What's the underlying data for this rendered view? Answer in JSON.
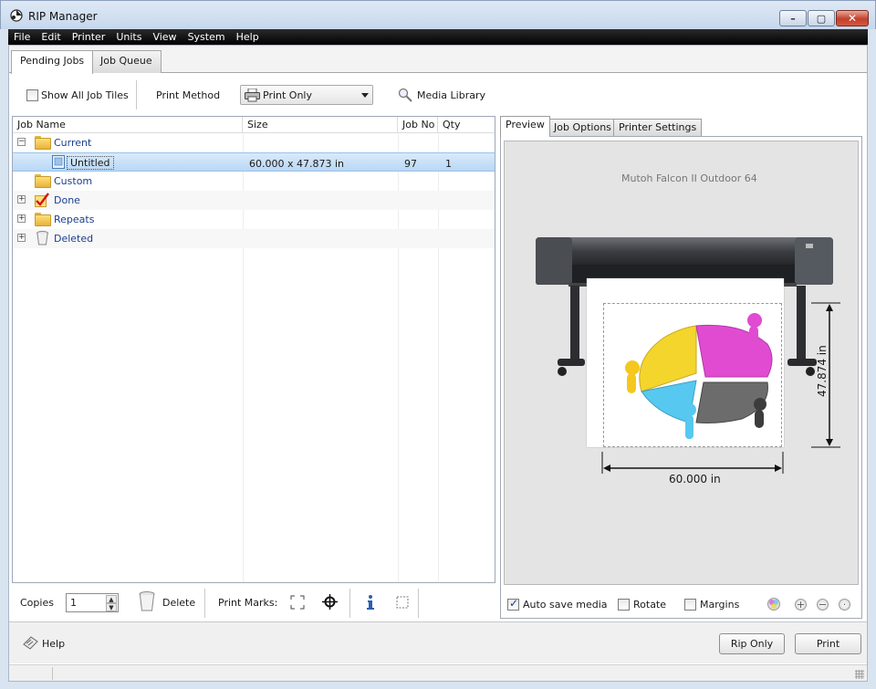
{
  "window": {
    "title": "RIP Manager"
  },
  "menu": [
    "File",
    "Edit",
    "Printer",
    "Units",
    "View",
    "System",
    "Help"
  ],
  "top_tabs": [
    {
      "label": "Pending Jobs",
      "active": true
    },
    {
      "label": "Job Queue",
      "active": false
    }
  ],
  "toolbar": {
    "show_all_tiles_label": "Show All Job Tiles",
    "show_all_tiles_checked": false,
    "print_method_label": "Print Method",
    "print_method_value": "Print Only",
    "media_library_label": "Media Library"
  },
  "job_list": {
    "columns": [
      "Job Name",
      "Size",
      "Job No",
      "Qty"
    ],
    "folders": {
      "current": "Current",
      "custom": "Custom",
      "done": "Done",
      "repeats": "Repeats",
      "deleted": "Deleted"
    },
    "job": {
      "name": "Untitled",
      "size": "60.000 x 47.873  in",
      "job_no": "97",
      "qty": "1"
    }
  },
  "bottom_left": {
    "copies_label": "Copies",
    "copies_value": "1",
    "delete_label": "Delete",
    "print_marks_label": "Print Marks:"
  },
  "preview": {
    "tabs": [
      {
        "label": "Preview",
        "active": true
      },
      {
        "label": "Job Options",
        "active": false
      },
      {
        "label": "Printer Settings",
        "active": false
      }
    ],
    "printer_name": "Mutoh Falcon II Outdoor 64",
    "width_label": "60.000 in",
    "height_label": "47.874 in",
    "auto_save_label": "Auto save media",
    "auto_save_checked": true,
    "rotate_label": "Rotate",
    "rotate_checked": false,
    "margins_label": "Margins",
    "margins_checked": false
  },
  "footer": {
    "help_label": "Help",
    "rip_only_label": "Rip Only",
    "print_label": "Print"
  },
  "colors": {
    "title_bar": "#c6d7ec",
    "menu_bar": "#000000",
    "folder_label": "#1b3f8f",
    "selection": "#b9d8f5",
    "close_button": "#c2402c",
    "pie_yellow": "#f5e23a",
    "pie_magenta": "#e24fd3",
    "pie_cyan": "#57c8f0",
    "pie_gray": "#6e6e6e"
  }
}
